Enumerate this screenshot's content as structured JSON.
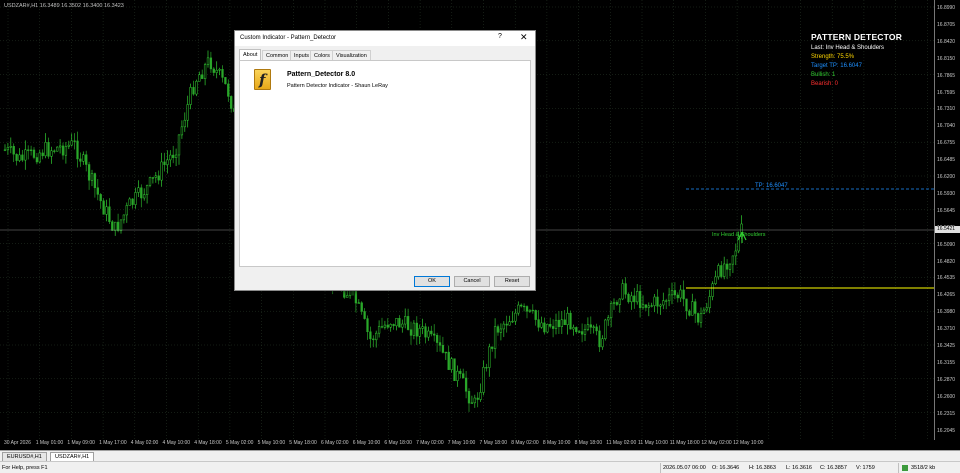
{
  "chart": {
    "symbol_label": "USDZAR#,H1   16.3489 16.3502 16.3400 16.3423",
    "current_price": "16.5421",
    "price_labels": [
      "16.8990",
      "16.8705",
      "16.8420",
      "16.8150",
      "16.7865",
      "16.7595",
      "16.7310",
      "16.7040",
      "16.6755",
      "16.6485",
      "16.6200",
      "16.5930",
      "16.5645",
      "16.5375",
      "16.5090",
      "16.4820",
      "16.4535",
      "16.4265",
      "16.3980",
      "16.3710",
      "16.3425",
      "16.3155",
      "16.2870",
      "16.2600",
      "16.2315",
      "16.2045"
    ],
    "time_labels": [
      "30 Apr 2026",
      "1 May 01:00",
      "1 May 09:00",
      "1 May 17:00",
      "4 May 02:00",
      "4 May 10:00",
      "4 May 18:00",
      "5 May 02:00",
      "5 May 10:00",
      "5 May 18:00",
      "6 May 02:00",
      "6 May 10:00",
      "6 May 18:00",
      "7 May 02:00",
      "7 May 10:00",
      "7 May 18:00",
      "8 May 02:00",
      "8 May 10:00",
      "8 May 18:00",
      "11 May 02:00",
      "11 May 10:00",
      "11 May 18:00",
      "12 May 02:00",
      "12 May 10:00"
    ],
    "tp_label": "TP: 16.6047",
    "pattern_mark": "Inv Head & Shoulders",
    "colors": {
      "bull": "#32cd32",
      "bear": "#2aa82a",
      "grid": "#2a3a2a",
      "tp_line": "#1e90ff",
      "neckline": "#ffff00",
      "price_line": "#8a8a8a"
    }
  },
  "pattern_panel": {
    "title": "PATTERN DETECTOR",
    "lines": [
      {
        "text": "Last: Inv Head & Shoulders",
        "color": "#ffffff"
      },
      {
        "text": "Strength: 75.5%",
        "color": "#ffd700"
      },
      {
        "text": "Target TP: 16.6047",
        "color": "#1e90ff"
      },
      {
        "text": "Bullish: 1",
        "color": "#32cd32"
      },
      {
        "text": "Bearish: 0",
        "color": "#ff3030"
      }
    ]
  },
  "dialog": {
    "title": "Custom Indicator - Pattern_Detector",
    "help": "?",
    "close": "✕",
    "tabs": [
      "About",
      "Common",
      "Inputs",
      "Colors",
      "Visualization"
    ],
    "indicator_name": "Pattern_Detector 8.0",
    "indicator_desc": "Pattern Detector Indicator - Shaun LeRay",
    "icon_letter": "f",
    "buttons": {
      "ok": "OK",
      "cancel": "Cancel",
      "reset": "Reset"
    }
  },
  "chart_tabs": [
    "EURUSD#,H1",
    "USDZAR#,H1"
  ],
  "status_bar": {
    "help": "For Help, press F1",
    "datetime": "2026.05.07 06:00",
    "open": "O: 16.3646",
    "high": "H: 16.3863",
    "low": "L: 16.3616",
    "close": "C: 16.3857",
    "volume": "V: 1759",
    "traffic": "3518/2 kb"
  }
}
